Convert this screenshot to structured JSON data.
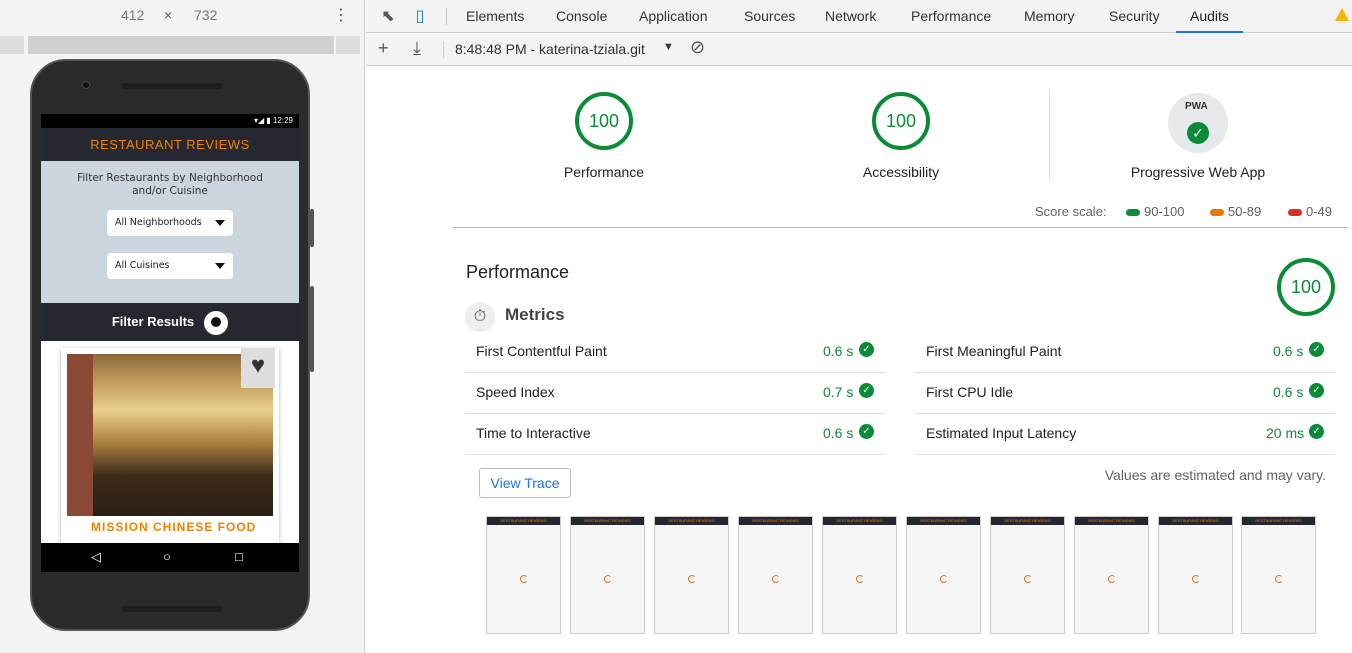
{
  "device": {
    "width": "412",
    "times": "×",
    "height": "732",
    "kebab": "⋮"
  },
  "phone": {
    "status_time": "12:29",
    "app_title": "RESTAURANT REVIEWS",
    "filter_heading": "Filter Restaurants by Neighborhood and/or Cuisine",
    "neighborhoods_select": "All Neighborhoods",
    "cuisines_select": "All Cuisines",
    "filter_results": "Filter Results",
    "restaurant_name": "MISSION CHINESE FOOD",
    "nav_back": "◁",
    "nav_home": "○",
    "nav_recent": "□"
  },
  "devtools": {
    "tabs": [
      "Elements",
      "Console",
      "Application",
      "Sources",
      "Network",
      "Performance",
      "Memory",
      "Security",
      "Audits"
    ],
    "active_tab": "Audits",
    "report_selector": "8:48:48 PM - katerina-tziala.git"
  },
  "summary": {
    "performance": {
      "score": "100",
      "label": "Performance"
    },
    "accessibility": {
      "score": "100",
      "label": "Accessibility"
    },
    "pwa": {
      "badge": "PWA",
      "label": "Progressive Web App"
    }
  },
  "scale": {
    "label": "Score scale:",
    "good": "90-100",
    "average": "50-89",
    "poor": "0-49",
    "colors": {
      "good": "#0c8b37",
      "average": "#e67700",
      "poor": "#d93025"
    }
  },
  "performance_section": {
    "title": "Performance",
    "score": "100",
    "metrics_heading": "Metrics",
    "metrics": [
      {
        "name": "First Contentful Paint",
        "value": "0.6 s"
      },
      {
        "name": "First Meaningful Paint",
        "value": "0.6 s"
      },
      {
        "name": "Speed Index",
        "value": "0.7 s"
      },
      {
        "name": "First CPU Idle",
        "value": "0.6 s"
      },
      {
        "name": "Time to Interactive",
        "value": "0.6 s"
      },
      {
        "name": "Estimated Input Latency",
        "value": "20 ms"
      }
    ],
    "view_trace": "View Trace",
    "note": "Values are estimated and may vary.",
    "filmstrip_frame_label": "RESTAURANT REVIEWS"
  }
}
